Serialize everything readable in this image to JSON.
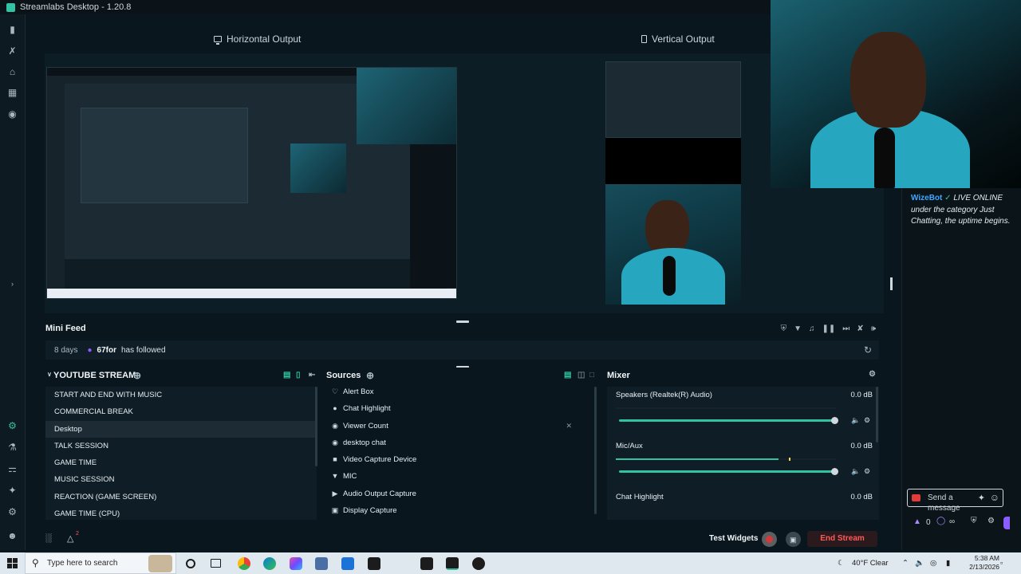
{
  "window": {
    "title": "Streamlabs Desktop - 1.20.8"
  },
  "studio": {
    "horizontal_label": "Horizontal Output",
    "vertical_label": "Vertical Output"
  },
  "chat": {
    "bot_name": "WizeBot",
    "check_mark": "✓",
    "status": "LIVE",
    "message": "ONLINE under the category Just Chatting, the uptime begins.",
    "send_placeholder": "Send a message",
    "points": "0",
    "infinity": "∞"
  },
  "mini_feed": {
    "title": "Mini Feed",
    "event": {
      "time": "8 days",
      "user": "67for",
      "action": "has followed"
    }
  },
  "scenes": {
    "title": "YOUTUBE STREAM",
    "items": [
      {
        "label": "START AND END WITH MUSIC"
      },
      {
        "label": "COMMERCIAL BREAK"
      },
      {
        "label": "Desktop"
      },
      {
        "label": "TALK SESSION"
      },
      {
        "label": "GAME TIME"
      },
      {
        "label": "MUSIC SESSION"
      },
      {
        "label": "REACTION (GAME SCREEN)"
      },
      {
        "label": "GAME TIME (CPU)"
      }
    ],
    "active_index": 2
  },
  "sources": {
    "title": "Sources",
    "items": [
      {
        "label": "Alert Box",
        "icon": "bell-icon"
      },
      {
        "label": "Chat Highlight",
        "icon": "chat-icon"
      },
      {
        "label": "Viewer Count",
        "icon": "eye-icon"
      },
      {
        "label": "desktop chat",
        "icon": "globe-icon"
      },
      {
        "label": "Video Capture Device",
        "icon": "camera-icon"
      },
      {
        "label": "MIC",
        "icon": "mic-icon"
      },
      {
        "label": "Audio Output Capture",
        "icon": "speaker-icon"
      },
      {
        "label": "Display Capture",
        "icon": "monitor-icon"
      }
    ]
  },
  "mixer": {
    "title": "Mixer",
    "channels": [
      {
        "name": "Speakers (Realtek(R) Audio)",
        "db": "0.0 dB",
        "level": 0.0,
        "volume": 1.0
      },
      {
        "name": "Mic/Aux",
        "db": "0.0 dB",
        "level": 0.74,
        "volume": 1.0
      },
      {
        "name": "Chat Highlight",
        "db": "0.0 dB",
        "level": 0.0,
        "volume": 1.0
      }
    ]
  },
  "footer": {
    "test_widgets": "Test Widgets",
    "end_stream": "End Stream",
    "notification_count": "2"
  },
  "taskbar": {
    "search_placeholder": "Type here to search",
    "weather": "40°F  Clear",
    "time": "5:38 AM",
    "date": "2/13/2026"
  },
  "colors": {
    "accent": "#31c3a2",
    "live_red": "#e33a3a",
    "end_stream": "#ff5a5a",
    "bot_blue": "#3da8ff"
  }
}
